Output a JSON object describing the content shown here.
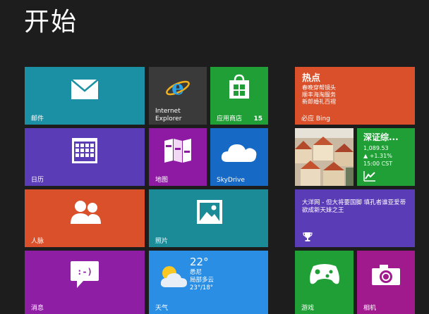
{
  "screen": {
    "title": "开始"
  },
  "colors": {
    "background": "#1d1d1d",
    "teal": "#1b8fa3",
    "green": "#1f9f35",
    "purple": "#5b3cb7",
    "magenta": "#8e1aa4",
    "blue": "#1769c6",
    "orange": "#d9502a",
    "sky": "#2a8ee4"
  },
  "tiles": {
    "mail": {
      "label": "邮件",
      "icon": "envelope-icon"
    },
    "ie": {
      "label_line1": "Internet",
      "label_line2": "Explorer",
      "icon": "internet-explorer-icon"
    },
    "store": {
      "label": "应用商店",
      "badge": "15",
      "icon": "store-bag-icon"
    },
    "calendar": {
      "label": "日历",
      "icon": "calendar-icon"
    },
    "maps": {
      "label": "地图",
      "icon": "map-icon"
    },
    "skydrive": {
      "label": "SkyDrive",
      "icon": "cloud-icon"
    },
    "people": {
      "label": "人脉",
      "icon": "people-icon"
    },
    "photos": {
      "label": "照片",
      "icon": "picture-icon"
    },
    "messaging": {
      "label": "消息",
      "icon": "speech-bubble-icon"
    },
    "weather": {
      "label": "天气",
      "icon": "sun-cloud-icon",
      "temperature": "22°",
      "city": "悉尼",
      "condition": "局部多云",
      "range": "23°/18°"
    },
    "news": {
      "headline": "热点",
      "lines": [
        "春晚穿帮镜头",
        "顺丰海淘服务",
        "新郎婚礼百褶"
      ],
      "source": "必应 Bing"
    },
    "photo_live": {
      "icon": "city-photo"
    },
    "finance": {
      "name": "深证综...",
      "value": "1,089.53",
      "change": "▲ +1.31%",
      "time": "15:00 CST",
      "icon": "stock-chart-icon"
    },
    "sports": {
      "text": "大洋网 - 但大将要国脚 填孔者谁亚爱蒂欲成新天妹之王",
      "icon": "trophy-icon"
    },
    "games": {
      "label": "游戏",
      "icon": "gamepad-icon"
    },
    "camera": {
      "label": "相机",
      "icon": "camera-icon"
    }
  }
}
